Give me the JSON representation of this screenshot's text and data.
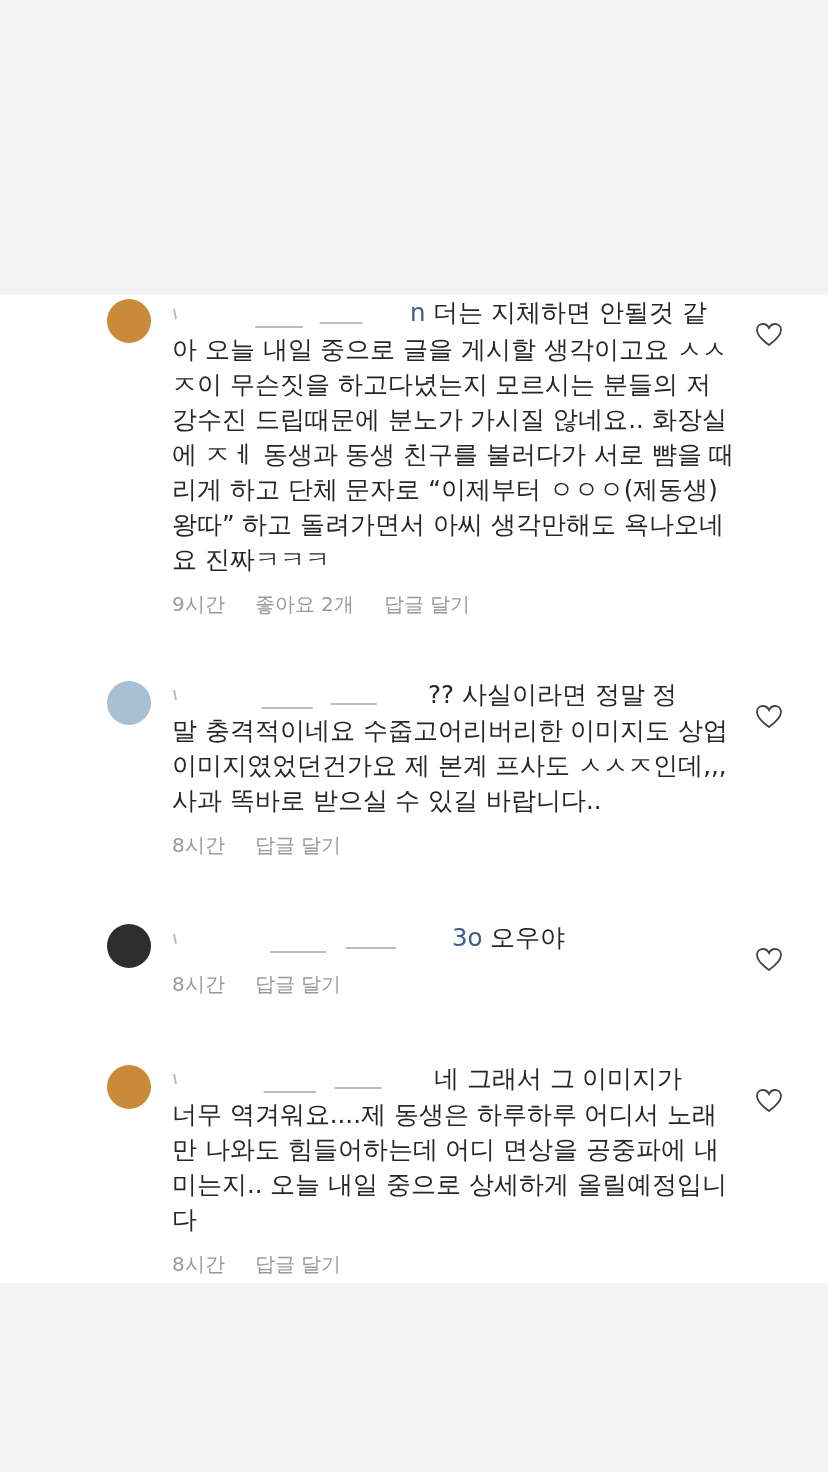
{
  "comments": [
    {
      "color": "#c98a3a",
      "mention_tail": "n",
      "lines": [
        "더는 지체하면 안될것 같",
        "아 오늘 내일 중으로 글을 게시할 생각이고요 ㅅㅅ",
        "ㅈ이 무슨짓을 하고다녔는지 모르시는 분들의 저",
        "강수진 드립때문에 분노가 가시질 않네요.. 화장실",
        "에 ㅈㅔ 동생과 동생 친구를 불러다가 서로 뺨을 때",
        "리게 하고 단체 문자로 “이제부터 ㅇㅇㅇ(제동생)",
        "왕따” 하고 돌려가면서 아씨 생각만해도 욕나오네",
        "요 진짜ㅋㅋㅋ"
      ],
      "time": "9시간",
      "likes": "좋아요 2개",
      "reply": "답글 달기",
      "liked": false
    },
    {
      "color": "#a9bfd2",
      "lines": [
        "?? 사실이라면 정말 정",
        "말 충격적이네요 수줍고어리버리한 이미지도 상업",
        "이미지였었던건가요 제 본계 프사도 ㅅㅅㅈ인데,,,",
        "사과 똑바로 받으실 수 있길 바랍니다.."
      ],
      "time": "8시간",
      "reply": "답글 달기",
      "liked": false
    },
    {
      "color": "#2e2e2e",
      "mention_tail": "3o",
      "lines": [
        "오우야"
      ],
      "time": "8시간",
      "reply": "답글 달기",
      "liked": false
    },
    {
      "color": "#c98a3a",
      "lines": [
        "네 그래서 그 이미지가",
        "너무 역겨워요....제 동생은 하루하루 어디서 노래",
        "만 나와도 힘들어하는데 어디 면상을 공중파에 내",
        "미는지.. 오늘 내일 중으로 상세하게 올릴예정입니",
        "다"
      ],
      "time": "8시간",
      "reply": "답글 달기",
      "liked": false
    }
  ]
}
